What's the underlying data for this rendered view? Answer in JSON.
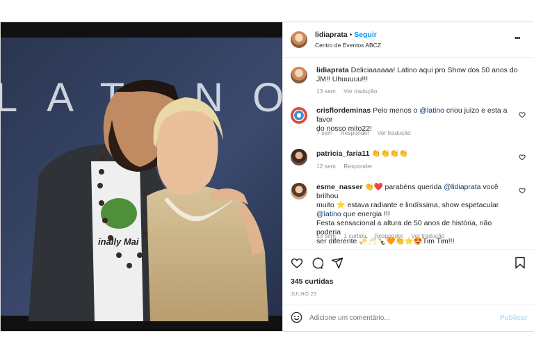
{
  "post": {
    "username": "lidiaprata",
    "follow_label": "Seguir",
    "location": "Centro de Eventos ABCZ",
    "more_label": "•••",
    "photo_backdrop_text": "LATINO"
  },
  "caption": {
    "username": "lidiaprata",
    "line1": "Deliciaaaaaa! Latino aqui pro Show dos 50 anos do",
    "line2": "JM!! Uhuuuuu!!!",
    "time": "13 sem",
    "translate": "Ver tradução"
  },
  "comments": [
    {
      "username": "crisflordeminas",
      "line1_pre": " Pelo menos o ",
      "mention": "@latino",
      "line1_post": " criou juizo e esta a favor",
      "line2": "do nosso mito22!",
      "time": "7 sem",
      "reply": "Responder",
      "translate": "Ver tradução"
    },
    {
      "username": "patricia_faria11",
      "text": " 👏👏👏👏",
      "time": "12 sem",
      "reply": "Responder"
    },
    {
      "username": "esme_nasser",
      "line1_a": " 👏❤️ parabéns querida ",
      "mention1": "@lidiaprata",
      "line1_b": " você brilhou",
      "line2": "muito ⭐ estava radiante e lindíssima, show espetacular",
      "mention2": "@latino",
      "line3_b": " que energia !!!",
      "line4": "Festa sensacional a altura de 50 anos de história, não poderia",
      "line5": "ser diferente 🎺🥂🍾🧡👏⭐😍Tim Tim!!!",
      "time": "13 sem",
      "likes": "1 curtida",
      "reply": "Responder",
      "translate": "Ver tradução"
    }
  ],
  "actions": {
    "likes": "345 curtidas",
    "date": "JULHO 23"
  },
  "composer": {
    "placeholder": "Adicione um comentário...",
    "publish": "Publicar"
  },
  "icons": [
    "heart-icon",
    "comment-icon",
    "share-icon",
    "bookmark-icon",
    "more-icon",
    "emoji-icon",
    "like-comment-icon"
  ],
  "colors": {
    "link": "#0095f6",
    "mention": "#00376b",
    "muted": "#8e8e8e",
    "publish_disabled": "#b2dffc"
  }
}
